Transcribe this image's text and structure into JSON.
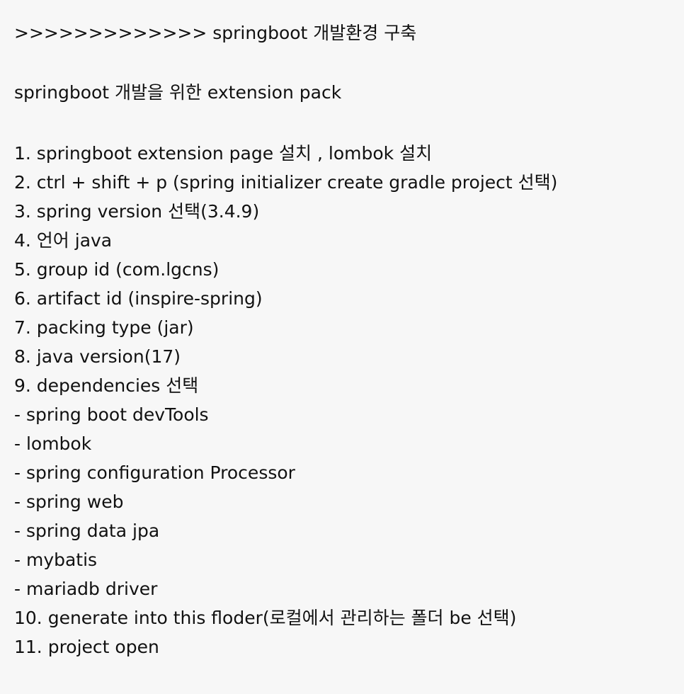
{
  "document": {
    "heading": ">>>>>>>>>>>>> springboot 개발환경 구축",
    "subtitle": "springboot 개발을 위한 extension pack",
    "lines": [
      "1. springboot extension page 설치 , lombok 설치",
      "2. ctrl + shift + p (spring initializer create gradle project 선택)",
      "3. spring version 선택(3.4.9)",
      "4. 언어 java",
      "5. group id (com.lgcns)",
      "6. artifact id (inspire-spring)",
      "7. packing type (jar)",
      "8. java version(17)",
      "9. dependencies 선택",
      "- spring boot devTools",
      "- lombok",
      "- spring configuration Processor",
      "- spring web",
      "- spring data jpa",
      "- mybatis",
      "- mariadb driver",
      "10. generate into this floder(로컬에서 관리하는 폴더 be 선택)",
      "11. project open"
    ]
  }
}
